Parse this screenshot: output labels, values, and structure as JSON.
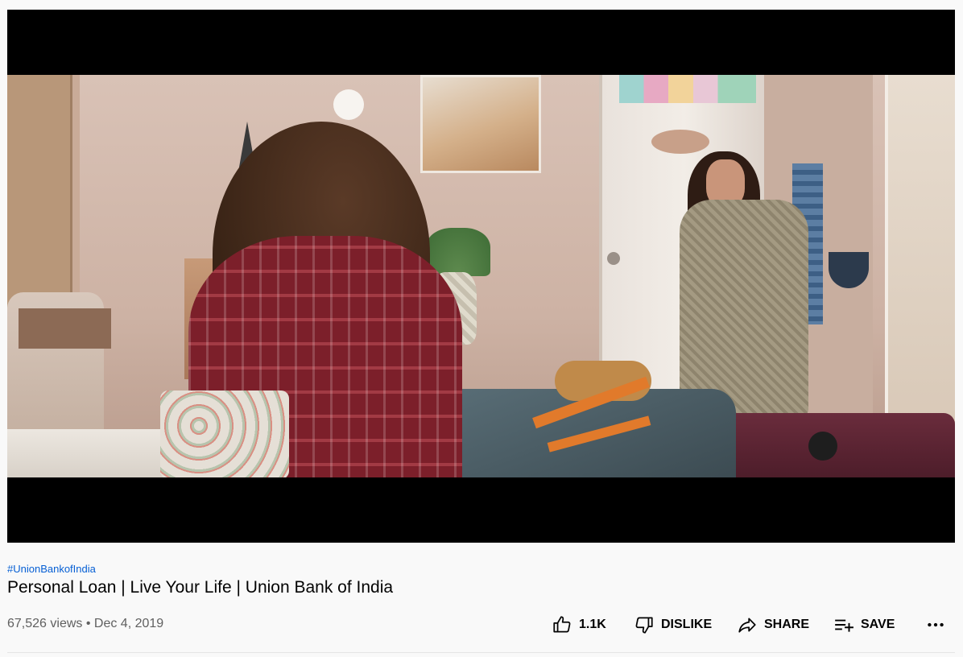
{
  "video": {
    "hashtag": "#UnionBankofIndia",
    "title": "Personal Loan | Live Your Life | Union Bank of India",
    "views": "67,526 views",
    "separator": "•",
    "date": "Dec 4, 2019"
  },
  "actions": {
    "like_count": "1.1K",
    "dislike_label": "DISLIKE",
    "share_label": "SHARE",
    "save_label": "SAVE"
  },
  "icons": {
    "like": "thumbs-up-icon",
    "dislike": "thumbs-down-icon",
    "share": "share-arrow-icon",
    "save": "playlist-add-icon",
    "more": "more-horizontal-icon"
  },
  "colors": {
    "hashtag": "#065fd4",
    "title": "#030303",
    "meta": "#606060",
    "background": "#f9f9f9"
  }
}
